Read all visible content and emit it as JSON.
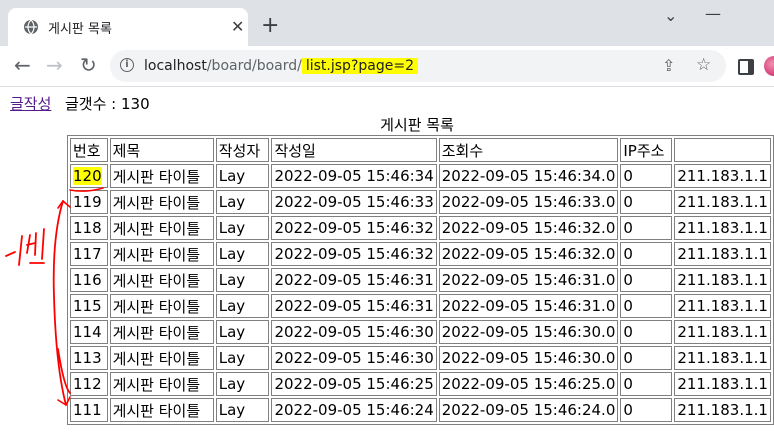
{
  "browser": {
    "tab_title": "게시판 목록",
    "tab_close": "✕",
    "new_tab": "+",
    "minimize": "⌄",
    "maximize": "—",
    "url_host": "localhost",
    "url_path": "/board/board/",
    "url_highlight": "list.jsp?page=2",
    "back": "←",
    "forward": "→",
    "reload": "↻",
    "share": "⇪",
    "star": "☆"
  },
  "page": {
    "write_link": "글작성",
    "count_label": "글갯수 : 130",
    "caption": "게시판 목록"
  },
  "table": {
    "headers": [
      "번호",
      "제목",
      "작성자",
      "작성일",
      "조회수",
      "IP주소",
      ""
    ],
    "rows": [
      [
        "120",
        "게시판 타이틀",
        "Lay",
        "2022-09-05 15:46:34",
        "2022-09-05 15:46:34.0",
        "0",
        "211.183.1.1"
      ],
      [
        "119",
        "게시판 타이틀",
        "Lay",
        "2022-09-05 15:46:33",
        "2022-09-05 15:46:33.0",
        "0",
        "211.183.1.1"
      ],
      [
        "118",
        "게시판 타이틀",
        "Lay",
        "2022-09-05 15:46:32",
        "2022-09-05 15:46:32.0",
        "0",
        "211.183.1.1"
      ],
      [
        "117",
        "게시판 타이틀",
        "Lay",
        "2022-09-05 15:46:32",
        "2022-09-05 15:46:32.0",
        "0",
        "211.183.1.1"
      ],
      [
        "116",
        "게시판 타이틀",
        "Lay",
        "2022-09-05 15:46:31",
        "2022-09-05 15:46:31.0",
        "0",
        "211.183.1.1"
      ],
      [
        "115",
        "게시판 타이틀",
        "Lay",
        "2022-09-05 15:46:31",
        "2022-09-05 15:46:31.0",
        "0",
        "211.183.1.1"
      ],
      [
        "114",
        "게시판 타이틀",
        "Lay",
        "2022-09-05 15:46:30",
        "2022-09-05 15:46:30.0",
        "0",
        "211.183.1.1"
      ],
      [
        "113",
        "게시판 타이틀",
        "Lay",
        "2022-09-05 15:46:30",
        "2022-09-05 15:46:30.0",
        "0",
        "211.183.1.1"
      ],
      [
        "112",
        "게시판 타이틀",
        "Lay",
        "2022-09-05 15:46:25",
        "2022-09-05 15:46:25.0",
        "0",
        "211.183.1.1"
      ],
      [
        "111",
        "게시판 타이틀",
        "Lay",
        "2022-09-05 15:46:24",
        "2022-09-05 15:46:24.0",
        "0",
        "211.183.1.1"
      ]
    ]
  },
  "annotation": {
    "handwritten_text": "-1씩",
    "ink_color": "#ff0000",
    "highlight_color": "#ffff00"
  }
}
